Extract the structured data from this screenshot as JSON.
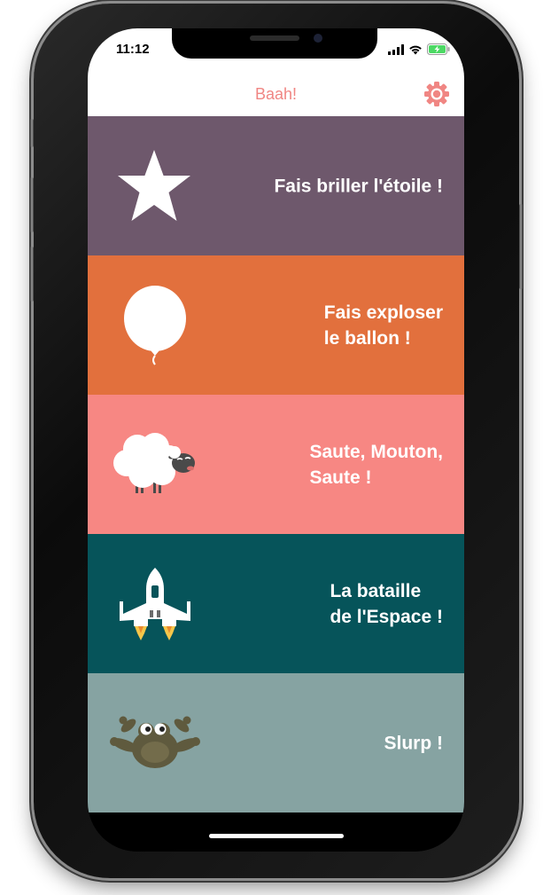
{
  "status_bar": {
    "time": "11:12",
    "icons": [
      "signal-icon",
      "wifi-icon",
      "battery-charging-icon"
    ]
  },
  "nav": {
    "title": "Baah!",
    "settings_icon": "gear-icon"
  },
  "colors": {
    "accent": "#f08683",
    "star_row": "#6e586c",
    "balloon_row": "#e2703d",
    "sheep_row": "#f78783",
    "space_row": "#06545a",
    "frog_row": "#86a3a2"
  },
  "games": [
    {
      "id": "star",
      "icon": "star-icon",
      "lines": [
        "Fais briller l'étoile !"
      ]
    },
    {
      "id": "balloon",
      "icon": "balloon-icon",
      "lines": [
        "Fais exploser",
        "le ballon !"
      ]
    },
    {
      "id": "sheep",
      "icon": "sheep-icon",
      "lines": [
        "Saute, Mouton,",
        "Saute !"
      ]
    },
    {
      "id": "space",
      "icon": "spaceship-icon",
      "lines": [
        "La bataille",
        "de l'Espace !"
      ]
    },
    {
      "id": "frog",
      "icon": "frog-icon",
      "lines": [
        "Slurp !"
      ]
    }
  ]
}
